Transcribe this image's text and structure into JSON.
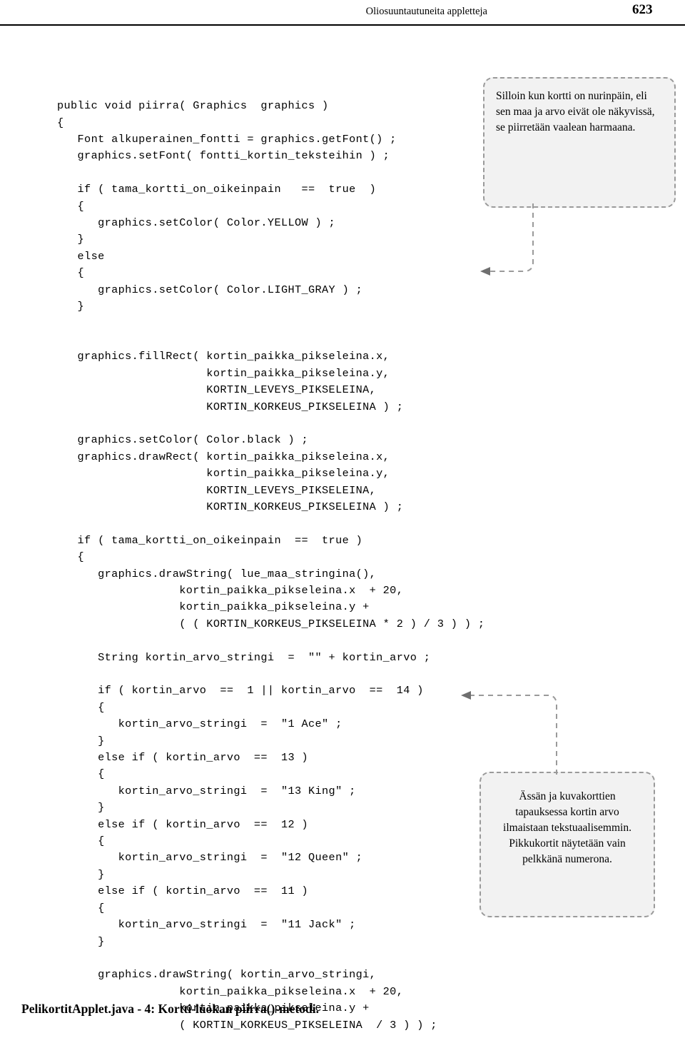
{
  "header": {
    "title": "Oliosuuntautuneita appletteja",
    "page_number": "623"
  },
  "code": {
    "language": "java",
    "text": "public void piirra( Graphics  graphics )\n{\n   Font alkuperainen_fontti = graphics.getFont() ;\n   graphics.setFont( fontti_kortin_teksteihin ) ;\n\n   if ( tama_kortti_on_oikeinpain   ==  true  )\n   {\n      graphics.setColor( Color.YELLOW ) ;\n   }\n   else\n   {\n      graphics.setColor( Color.LIGHT_GRAY ) ;\n   }\n\n\n   graphics.fillRect( kortin_paikka_pikseleina.x,\n                      kortin_paikka_pikseleina.y,\n                      KORTIN_LEVEYS_PIKSELEINA,\n                      KORTIN_KORKEUS_PIKSELEINA ) ;\n\n   graphics.setColor( Color.black ) ;\n   graphics.drawRect( kortin_paikka_pikseleina.x,\n                      kortin_paikka_pikseleina.y,\n                      KORTIN_LEVEYS_PIKSELEINA,\n                      KORTIN_KORKEUS_PIKSELEINA ) ;\n\n   if ( tama_kortti_on_oikeinpain  ==  true )\n   {\n      graphics.drawString( lue_maa_stringina(),\n                  kortin_paikka_pikseleina.x  + 20,\n                  kortin_paikka_pikseleina.y +\n                  ( ( KORTIN_KORKEUS_PIKSELEINA * 2 ) / 3 ) ) ;\n\n      String kortin_arvo_stringi  =  \"\" + kortin_arvo ;\n\n      if ( kortin_arvo  ==  1 || kortin_arvo  ==  14 )\n      {\n         kortin_arvo_stringi  =  \"1 Ace\" ;\n      }\n      else if ( kortin_arvo  ==  13 )\n      {\n         kortin_arvo_stringi  =  \"13 King\" ;\n      }\n      else if ( kortin_arvo  ==  12 )\n      {\n         kortin_arvo_stringi  =  \"12 Queen\" ;\n      }\n      else if ( kortin_arvo  ==  11 )\n      {\n         kortin_arvo_stringi  =  \"11 Jack\" ;\n      }\n\n      graphics.drawString( kortin_arvo_stringi,\n                  kortin_paikka_pikseleina.x  + 20,\n                  kortin_paikka_pikseleina.y +\n                  ( KORTIN_KORKEUS_PIKSELEINA  / 3 ) ) ;"
  },
  "callouts": [
    {
      "id": "callout-card-orientation",
      "text": "Silloin kun kortti on nurinpäin, eli sen maa ja arvo eivät ole näkyvissä, se piirretään vaalean harmaana."
    },
    {
      "id": "callout-face-cards",
      "text": "Ässän ja kuvakorttien tapauksessa kortin arvo ilmaistaan tekstuaalisemmin. Pikkukortit näytetään vain pelkkänä numerona."
    }
  ],
  "caption": "PelikortitApplet.java - 4: Kortti-luokan piirra()-metodi."
}
